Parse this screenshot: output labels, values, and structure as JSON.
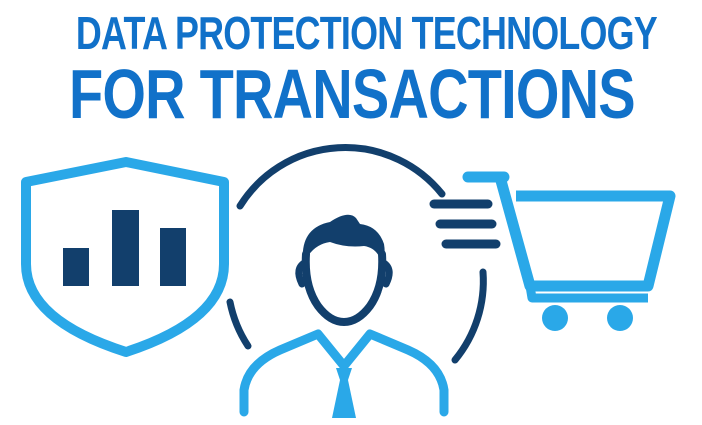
{
  "headline": {
    "line1": "DATA PROTECTION TECHNOLOGY",
    "line2": "FOR TRANSACTIONS"
  },
  "colors": {
    "primary_blue": "#1171c9",
    "light_blue": "#2aa8e8",
    "navy": "#123f6c",
    "background": "#ffffff"
  },
  "icons": [
    "shield-with-bar-chart-icon",
    "person-icon",
    "shopping-cart-icon"
  ]
}
